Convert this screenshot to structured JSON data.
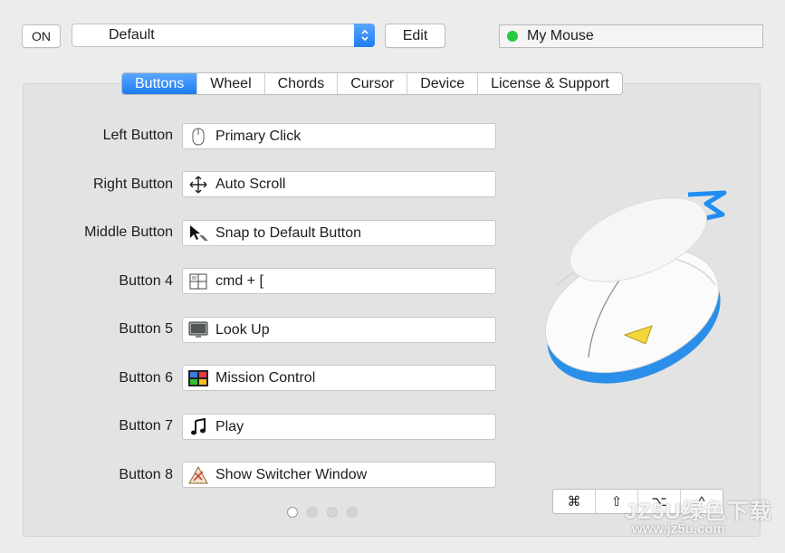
{
  "toolbar": {
    "on_label": "ON",
    "preset_value": "Default",
    "edit_label": "Edit",
    "device_name": "My Mouse",
    "device_status_color": "#27c93f"
  },
  "tabs": [
    {
      "label": "Buttons",
      "active": true
    },
    {
      "label": "Wheel",
      "active": false
    },
    {
      "label": "Chords",
      "active": false
    },
    {
      "label": "Cursor",
      "active": false
    },
    {
      "label": "Device",
      "active": false
    },
    {
      "label": "License & Support",
      "active": false
    }
  ],
  "buttons": [
    {
      "label": "Left Button",
      "action": "Primary Click",
      "icon": "mouse-icon"
    },
    {
      "label": "Right Button",
      "action": "Auto Scroll",
      "icon": "move-arrows-icon"
    },
    {
      "label": "Middle Button",
      "action": "Snap to Default Button",
      "icon": "cursor-snap-icon"
    },
    {
      "label": "Button 4",
      "action": "cmd + [",
      "icon": "keyboard-icon"
    },
    {
      "label": "Button 5",
      "action": "Look Up",
      "icon": "monitor-icon"
    },
    {
      "label": "Button 6",
      "action": "Mission Control",
      "icon": "mission-control-icon"
    },
    {
      "label": "Button 7",
      "action": "Play",
      "icon": "music-note-icon"
    },
    {
      "label": "Button 8",
      "action": "Show Switcher Window",
      "icon": "app-switcher-icon"
    }
  ],
  "pagination": {
    "pages": 4,
    "current": 1
  },
  "modifiers": [
    "⌘",
    "⇧",
    "⌥",
    "^"
  ],
  "colors": {
    "accent": "#1d7cf2",
    "mouse_trim": "#2a8fe8"
  },
  "watermark": {
    "main": "JZ5U绿色下载",
    "sub": "www.jz5u.com"
  }
}
